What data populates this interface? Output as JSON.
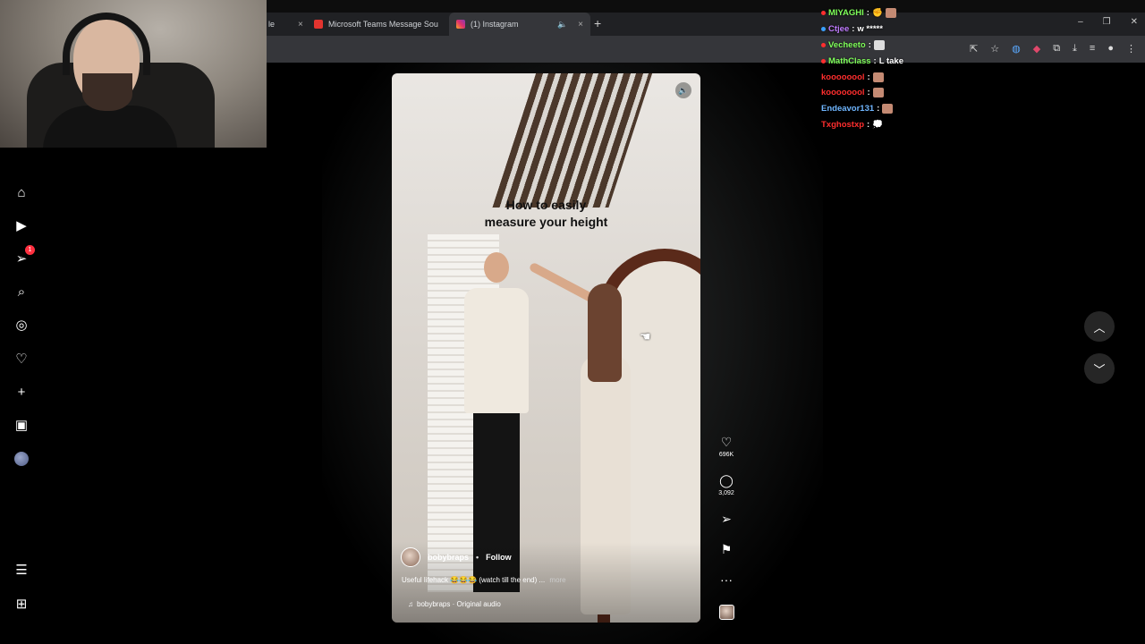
{
  "browser": {
    "tabs": [
      {
        "label": "le",
        "close": "×"
      },
      {
        "label": "Microsoft Teams Message Sou",
        "close": "×"
      },
      {
        "label": "(1) Instagram",
        "close": "×",
        "audio": "🔈"
      }
    ],
    "new_tab": "+",
    "window_controls": {
      "minimize": "–",
      "restore": "❐",
      "close": "✕"
    }
  },
  "nav": {
    "notification_count": "1"
  },
  "reel": {
    "overlay_title_line1": "How to easily",
    "overlay_title_line2": "measure your height",
    "username": "bobybraps",
    "dot": "•",
    "follow_label": "Follow",
    "caption": "Useful lifehack 😂😂😂 (watch till the end) ...",
    "more_label": "more",
    "audio_label": "bobybraps · Original audio"
  },
  "actions": {
    "likes": "696K",
    "comments": "3,092"
  },
  "chat": [
    {
      "user": "MIYAGHI",
      "user_color": "#7fff5a",
      "text": ""
    },
    {
      "user": "Ctjee",
      "user_color": "#c07bff",
      "text": "w *****"
    },
    {
      "user": "Vecheeto",
      "user_color": "#7fff5a",
      "text": ""
    },
    {
      "user": "MathClass",
      "user_color": "#7fff5a",
      "text": "L take"
    },
    {
      "user": "koooooool",
      "user_color": "#ff2e2e",
      "text": ""
    },
    {
      "user": "koooooool",
      "user_color": "#ff2e2e",
      "text": ""
    },
    {
      "user": "Endeavor131",
      "user_color": "#6fb6ff",
      "text": ""
    },
    {
      "user": "Txghostxp",
      "user_color": "#ff2e2e",
      "text": ""
    }
  ]
}
